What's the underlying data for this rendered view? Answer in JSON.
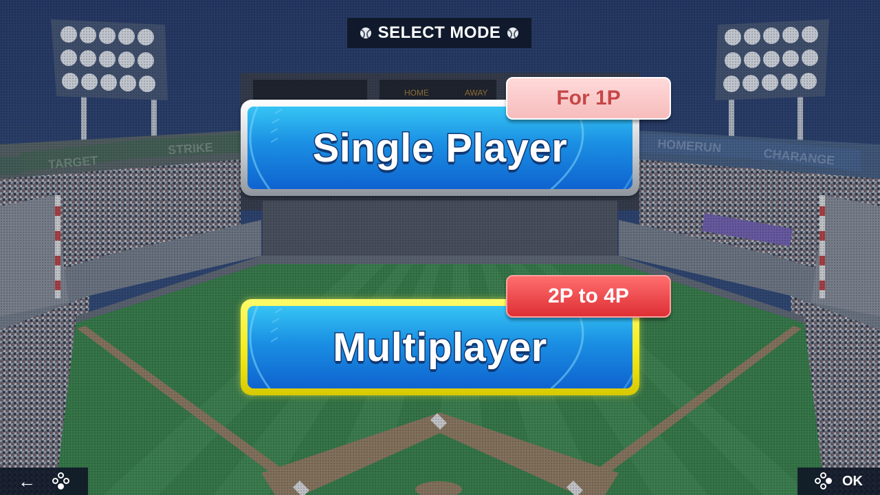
{
  "header": {
    "title": "SELECT MODE"
  },
  "scoreboard": {
    "home_label": "HOME",
    "away_label": "AWAY"
  },
  "signs": {
    "left_1": "TARGET",
    "left_2": "STRIKE",
    "right_1": "HOMERUN",
    "right_2": "CHARANGE"
  },
  "modes": [
    {
      "label": "Single Player",
      "tag": "For 1P",
      "selected": false
    },
    {
      "label": "Multiplayer",
      "tag": "2P to 4P",
      "selected": true
    }
  ],
  "footer": {
    "ok_label": "OK"
  },
  "colors": {
    "button_blue": "#1a8fe3",
    "selected_frame": "#f5ea1a",
    "tag_1p": "#f7bcbc",
    "tag_2p": "#de2f35"
  }
}
